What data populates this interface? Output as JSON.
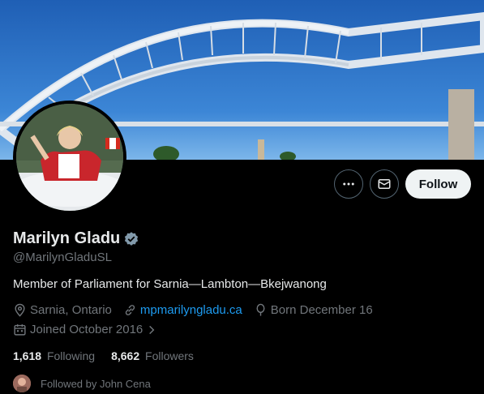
{
  "profile": {
    "name": "Marilyn Gladu",
    "handle": "@MarilynGladuSL",
    "bio": "Member of Parliament for Sarnia—Lambton—Bkejwanong",
    "location": "Sarnia, Ontario",
    "website": "mpmarilyngladu.ca",
    "birthday": "Born December 16",
    "joined": "Joined October 2016",
    "verified": true
  },
  "actions": {
    "follow_label": "Follow"
  },
  "stats": {
    "following_count": "1,618",
    "following_label": "Following",
    "followers_count": "8,662",
    "followers_label": "Followers"
  },
  "followed_by": "Followed by John Cena",
  "icons": {
    "verified": "verified-badge-icon",
    "location": "location-pin-icon",
    "link": "link-icon",
    "birthday": "balloon-icon",
    "joined": "calendar-icon",
    "more": "more-icon",
    "message": "mail-icon"
  },
  "colors": {
    "background": "#000000",
    "text_primary": "#e7e9ea",
    "text_secondary": "#71767b",
    "link": "#1d9bf0",
    "follow_button_bg": "#eff3f4"
  }
}
